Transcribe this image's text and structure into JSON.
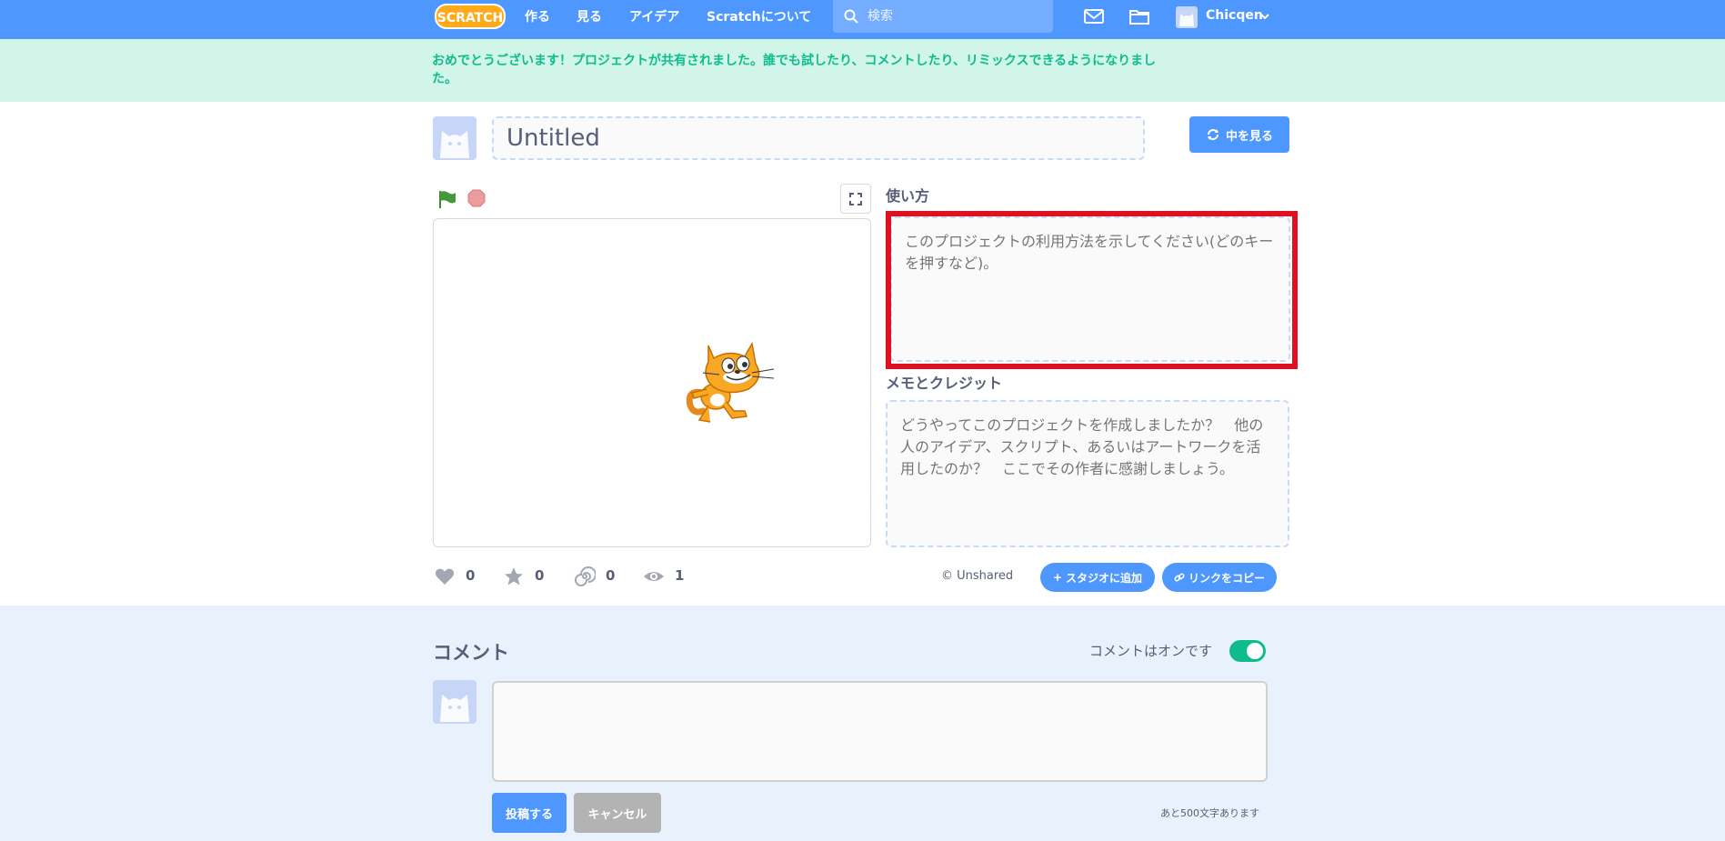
{
  "nav": {
    "logo_text": "SCRATCH",
    "links": [
      "作る",
      "見る",
      "アイデア",
      "Scratchについて"
    ],
    "search_placeholder": "検索",
    "username": "Chicqen"
  },
  "banner": {
    "message": "おめでとうございます！プロジェクトが共有されました。誰でも試したり、コメントしたり、リミックスできるようになりました。"
  },
  "project": {
    "title": "Untitled",
    "see_inside_label": "中を見る"
  },
  "instructions": {
    "label": "使い方",
    "placeholder": "このプロジェクトの利用方法を示してください(どのキーを押すなど)。"
  },
  "notes": {
    "label": "メモとクレジット",
    "placeholder": "どうやってこのプロジェクトを作成しましたか？　他の人のアイデア、スクリプト、あるいはアートワークを活用したのか？　ここでその作者に感謝しましょう。"
  },
  "stats": {
    "loves": "0",
    "favorites": "0",
    "remixes": "0",
    "views": "1"
  },
  "share": {
    "status": "Unshared",
    "add_studio_label": "スタジオに追加",
    "copy_link_label": "リンクをコピー"
  },
  "comments": {
    "title": "コメント",
    "toggle_label": "コメントはオンです",
    "post_label": "投稿する",
    "cancel_label": "キャンセル",
    "chars_left": "あと500文字あります"
  },
  "colors": {
    "brand": "#4d97ff",
    "banner_bg": "#d1f5e9",
    "banner_text": "#0fbd8c",
    "highlight": "#e0111f",
    "comments_bg": "#e9f1fc"
  }
}
